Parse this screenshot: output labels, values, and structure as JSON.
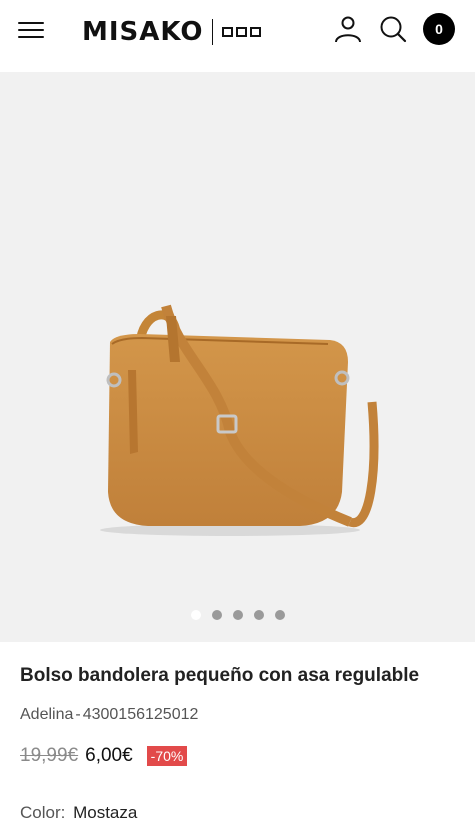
{
  "header": {
    "brand": "MISAKO",
    "cart_count": "0"
  },
  "gallery": {
    "slides_total": 5,
    "active_slide": 1
  },
  "product": {
    "title": "Bolso bandolera pequeño con asa regulable",
    "model": "Adelina",
    "sku_separator": "-",
    "sku": "4300156125012",
    "old_price": "19,99€",
    "price": "6,00€",
    "discount": "-70%",
    "color_label": "Color:",
    "color_value": "Mostaza"
  },
  "colors": {
    "discount_badge": "#e24a4a",
    "gallery_bg": "#f1f1f1",
    "bag": "#c98a3e"
  }
}
